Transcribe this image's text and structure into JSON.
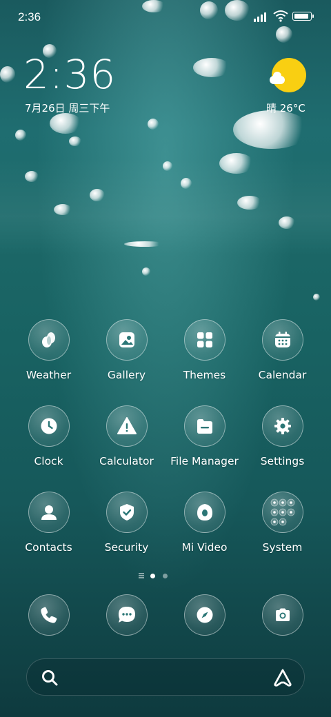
{
  "status_bar": {
    "time": "2:36",
    "battery_level": 0.9
  },
  "clock_widget": {
    "time": "2:36",
    "date": "7月26日 周三下午"
  },
  "weather_widget": {
    "condition_temp": "晴 26°C",
    "icon": "sun-cloud-icon"
  },
  "apps": [
    {
      "label": "Weather",
      "icon": "weather-icon"
    },
    {
      "label": "Gallery",
      "icon": "gallery-icon"
    },
    {
      "label": "Themes",
      "icon": "themes-icon"
    },
    {
      "label": "Calendar",
      "icon": "calendar-icon"
    },
    {
      "label": "Clock",
      "icon": "clock-icon"
    },
    {
      "label": "Calculator",
      "icon": "calculator-icon"
    },
    {
      "label": "File Manager",
      "icon": "file-manager-icon"
    },
    {
      "label": "Settings",
      "icon": "settings-icon"
    },
    {
      "label": "Contacts",
      "icon": "contacts-icon"
    },
    {
      "label": "Security",
      "icon": "security-icon"
    },
    {
      "label": "Mi Video",
      "icon": "mi-video-icon"
    },
    {
      "label": "System",
      "icon": "system-folder-icon"
    }
  ],
  "page_indicator": {
    "pages": 2,
    "current": 1
  },
  "dock": [
    {
      "icon": "phone-icon"
    },
    {
      "icon": "messages-icon"
    },
    {
      "icon": "browser-icon"
    },
    {
      "icon": "camera-icon"
    }
  ],
  "search_bar": {
    "search_icon": "search-icon",
    "assistant_icon": "assistant-icon"
  },
  "colors": {
    "sun": "#f9cf12",
    "icon_glyph": "#ffffff"
  }
}
